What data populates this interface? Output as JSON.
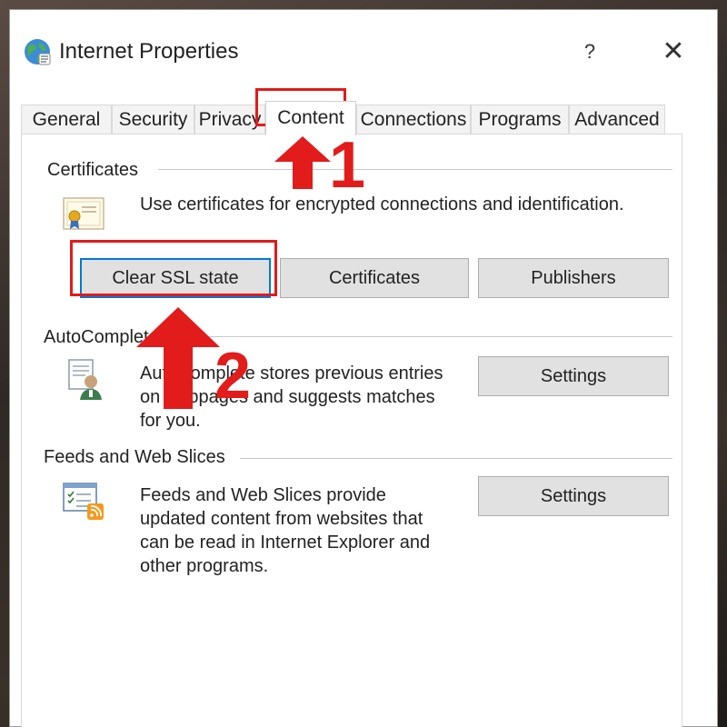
{
  "window": {
    "title": "Internet Properties",
    "help_label": "?",
    "close_label": "✕"
  },
  "tabs": [
    {
      "label": "General"
    },
    {
      "label": "Security"
    },
    {
      "label": "Privacy"
    },
    {
      "label": "Content"
    },
    {
      "label": "Connections"
    },
    {
      "label": "Programs"
    },
    {
      "label": "Advanced"
    }
  ],
  "active_tab": "Content",
  "certificates": {
    "heading": "Certificates",
    "description": "Use certificates for encrypted connections and identification.",
    "buttons": [
      "Clear SSL state",
      "Certificates",
      "Publishers"
    ]
  },
  "autocomplete": {
    "heading": "AutoComplete",
    "description_lines": [
      "AutoComplete stores previous entries",
      "on webpages and suggests matches",
      "for you."
    ],
    "button": "Settings"
  },
  "feeds": {
    "heading": "Feeds and Web Slices",
    "description_lines": [
      "Feeds and Web Slices provide",
      "updated content from websites that",
      "can be read in Internet Explorer and",
      "other programs."
    ],
    "button": "Settings"
  },
  "annotations": {
    "step1": "1",
    "step2": "2",
    "color": "#e21b1b"
  },
  "colors": {
    "focus_border": "#0078d7",
    "button_bg": "#e1e1e1"
  }
}
